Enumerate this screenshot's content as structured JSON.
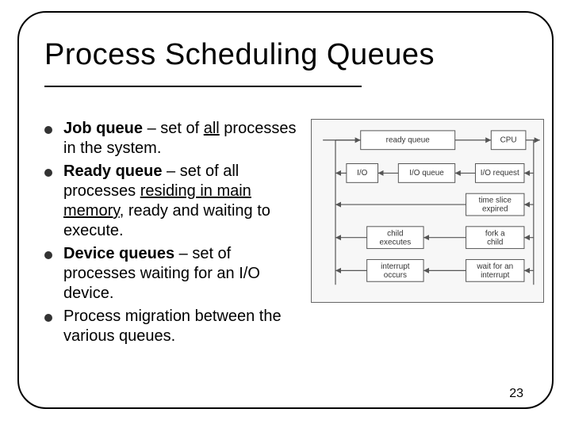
{
  "title": "Process Scheduling Queues",
  "bullets": [
    {
      "term": "Job queue",
      "rest_html": "<span> – set of <span class='u'>all</span> processes in the system.</span>"
    },
    {
      "term": "Ready queue",
      "rest_html": "<span> – set of all processes <span class='u'>residing in main memory</span>, ready and waiting to execute.</span>"
    },
    {
      "term": "Device queues",
      "rest_html": "<span> – set of processes waiting for an I/O device.</span>"
    },
    {
      "term": "",
      "rest_html": "<span>Process migration between the various queues.</span>"
    }
  ],
  "diagram": {
    "ready_queue": "ready queue",
    "cpu": "CPU",
    "io": "I/O",
    "io_queue": "I/O queue",
    "io_request": "I/O request",
    "time_slice_expired": "time slice\nexpired",
    "child_executes": "child\nexecutes",
    "fork_a_child": "fork a\nchild",
    "interrupt_occurs": "interrupt\noccurs",
    "wait_interrupt": "wait for an\ninterrupt"
  },
  "page_number": "23"
}
